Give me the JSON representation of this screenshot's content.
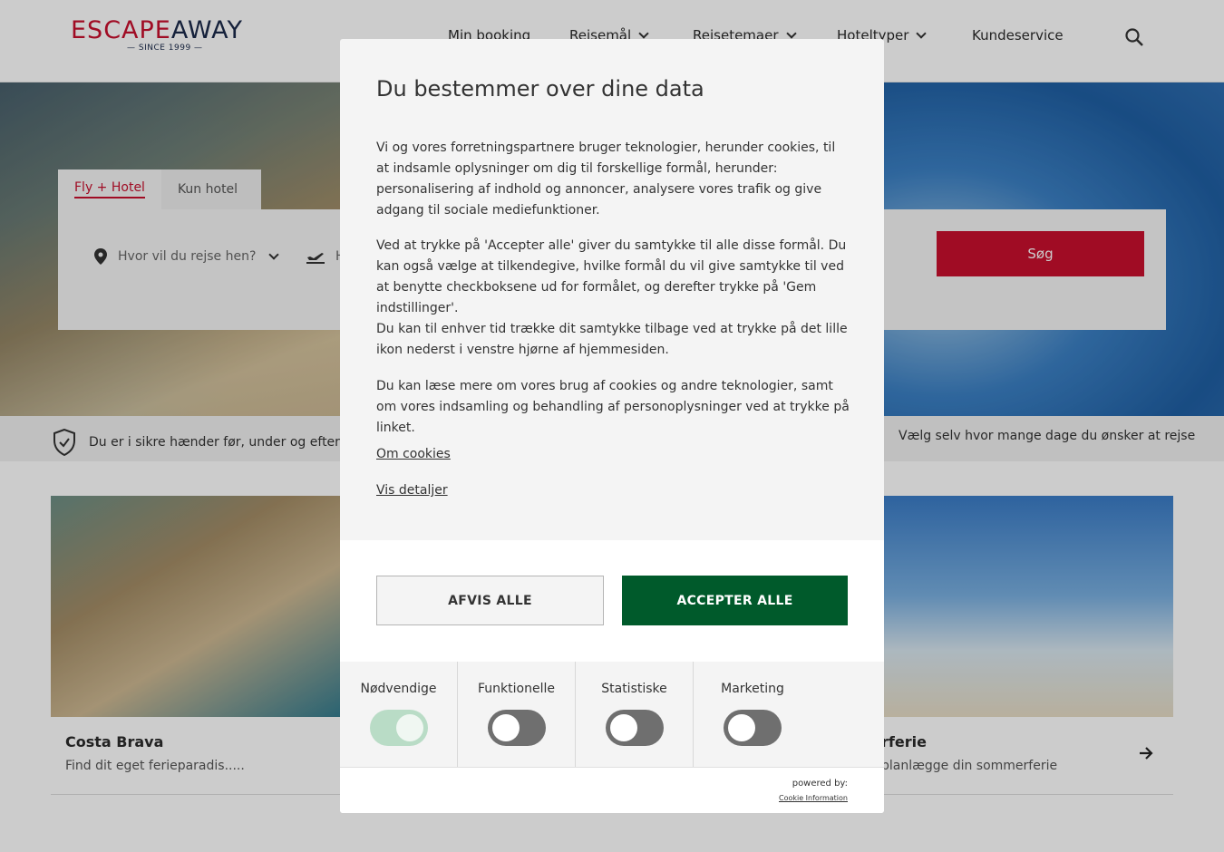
{
  "header": {
    "logo_main": "ESCAPEAWAY",
    "logo_since": "— SINCE 1999 —",
    "nav": [
      "Min booking",
      "Rejsemål",
      "Rejsetemaer",
      "Hoteltyper",
      "Kundeservice"
    ]
  },
  "search": {
    "tabs": [
      "Fly + Hotel",
      "Kun hotel"
    ],
    "destination_placeholder": "Hvor vil du rejse hen?",
    "departure_placeholder": "H",
    "button": "Søg"
  },
  "usps": {
    "left": "Du er i sikre hænder før, under og efter rejsen",
    "right": "Vælg selv hvor mange dage du ønsker at rejse"
  },
  "cards": [
    {
      "title": "Costa Brava",
      "desc": "Find dit eget ferieparadis....."
    },
    {
      "title": "rferie",
      "desc": "planlægge din sommerferie"
    }
  ],
  "consent": {
    "title": "Du bestemmer over dine data",
    "p1": "Vi og vores forretningspartnere bruger teknologier, herunder cookies, til at indsamle oplysninger om dig til forskellige formål, herunder: personalisering af indhold og annoncer, analysere vores trafik og give adgang til sociale mediefunktioner.",
    "p2": "Ved at trykke på 'Accepter alle' giver du samtykke til alle disse formål. Du kan også vælge at tilkendegive, hvilke formål du vil give samtykke til ved at benytte checkboksene ud for formålet, og derefter trykke på 'Gem indstillinger'.",
    "p3": "Du kan til enhver tid trække dit samtykke tilbage ved at trykke på det lille ikon nederst i venstre hjørne af hjemmesiden.",
    "p4": "Du kan læse mere om vores brug af cookies og andre teknologier, samt om vores indsamling og behandling af personoplysninger ved at trykke på linket.",
    "link_cookies": "Om cookies",
    "link_details": "Vis detaljer",
    "btn_reject": "AFVIS ALLE",
    "btn_accept": "ACCEPTER ALLE",
    "toggles": [
      {
        "label": "Nødvendige",
        "on": true
      },
      {
        "label": "Funktionelle",
        "on": false
      },
      {
        "label": "Statistiske",
        "on": false
      },
      {
        "label": "Marketing",
        "on": false
      }
    ],
    "powered_by": "powered by:",
    "cookie_information": "Cookie Information"
  },
  "colors": {
    "brand_red": "#c8102e",
    "accept_green": "#005a2b"
  }
}
